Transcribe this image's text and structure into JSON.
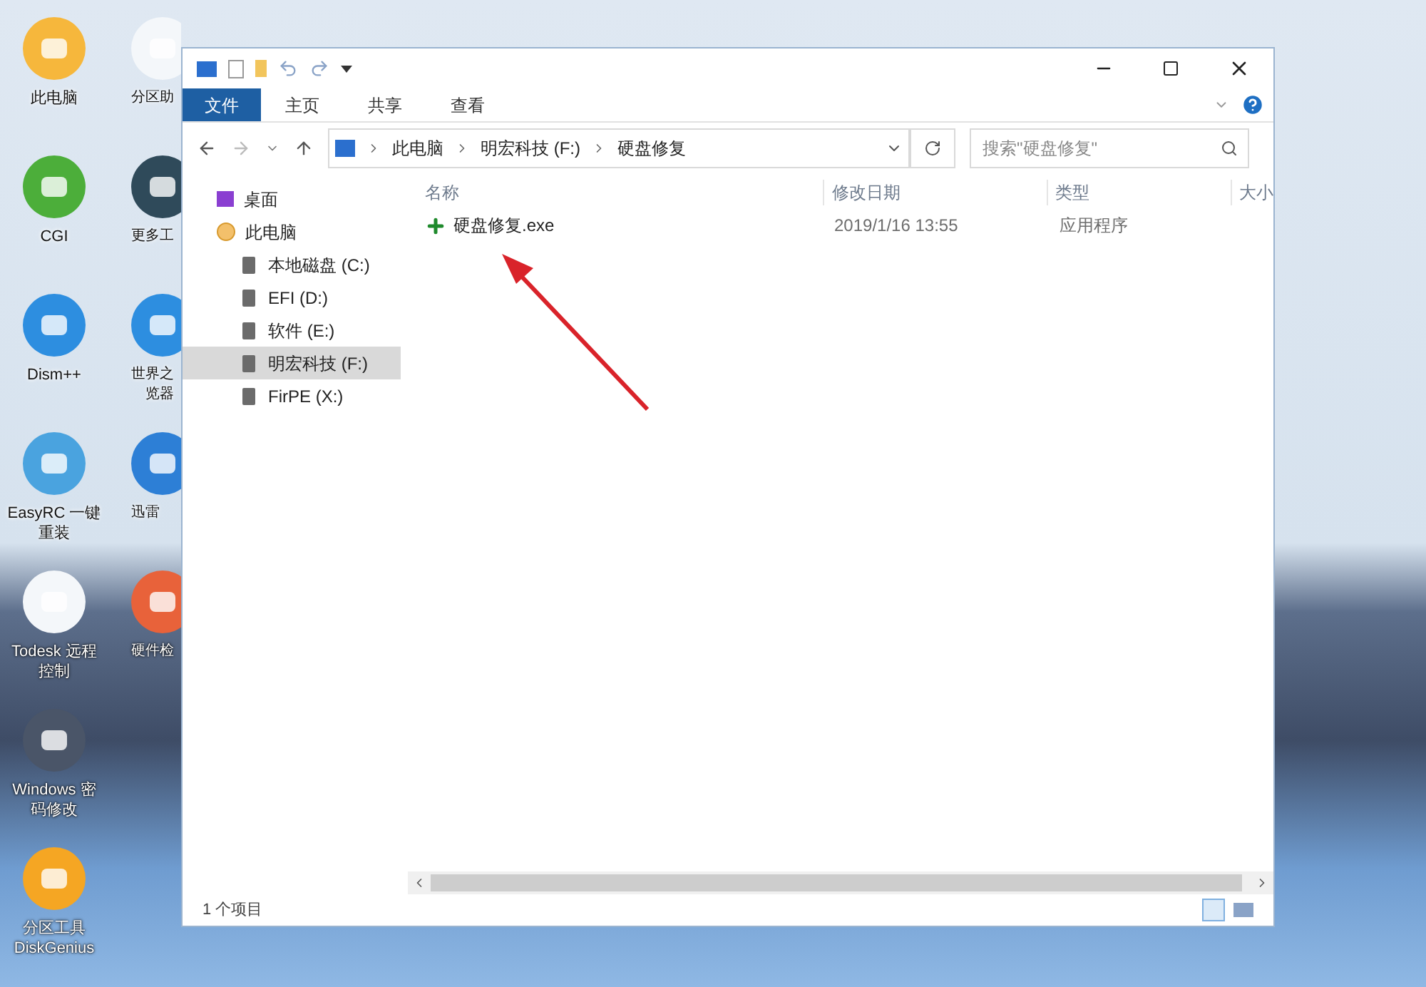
{
  "desktop_icons": [
    {
      "lines": [
        "此电脑"
      ],
      "color": "#f6b73c"
    },
    {
      "lines": [
        "CGI"
      ],
      "color": "#4cae3a"
    },
    {
      "lines": [
        "Dism++"
      ],
      "color": "#2d8ee0"
    },
    {
      "lines": [
        "EasyRC 一键",
        "重装"
      ],
      "color": "#4aa3df"
    },
    {
      "lines": [
        "Todesk 远程",
        "控制"
      ],
      "color": "#f4f7fa"
    },
    {
      "lines": [
        "Windows 密",
        "码修改"
      ],
      "color": "#4a5568"
    },
    {
      "lines": [
        "分区工具",
        "DiskGenius"
      ],
      "color": "#f5a623"
    },
    {
      "lines": [
        "分区助"
      ],
      "color": "#f4f7fa"
    },
    {
      "lines": [
        "更多工"
      ],
      "color": "#2f4a5a"
    },
    {
      "lines": [
        "世界之",
        "览器"
      ],
      "color": "#2d8ee0"
    },
    {
      "lines": [
        "迅雷"
      ],
      "color": "#2d7fd6"
    },
    {
      "lines": [
        "硬件检"
      ],
      "color": "#e8623a"
    }
  ],
  "window": {
    "ribbon_tabs": [
      {
        "label": "文件",
        "selected": true
      },
      {
        "label": "主页",
        "selected": false
      },
      {
        "label": "共享",
        "selected": false
      },
      {
        "label": "查看",
        "selected": false
      }
    ],
    "breadcrumb": [
      "此电脑",
      "明宏科技 (F:)",
      "硬盘修复"
    ],
    "search": {
      "placeholder": "搜索\"硬盘修复\""
    },
    "nav_items": [
      {
        "label": "桌面",
        "kind": "desktop",
        "selected": false
      },
      {
        "label": "此电脑",
        "kind": "pc",
        "selected": false,
        "children": [
          {
            "label": "本地磁盘 (C:)",
            "kind": "drive",
            "selected": false
          },
          {
            "label": "EFI (D:)",
            "kind": "drive",
            "selected": false
          },
          {
            "label": "软件 (E:)",
            "kind": "drive",
            "selected": false
          },
          {
            "label": "明宏科技 (F:)",
            "kind": "drive",
            "selected": true
          },
          {
            "label": "FirPE (X:)",
            "kind": "drive",
            "selected": false
          }
        ]
      }
    ],
    "columns": [
      "名称",
      "修改日期",
      "类型",
      "大小"
    ],
    "files": [
      {
        "name": "硬盘修复.exe",
        "modified": "2019/1/16 13:55",
        "type": "应用程序"
      }
    ],
    "status": "1 个项目"
  }
}
